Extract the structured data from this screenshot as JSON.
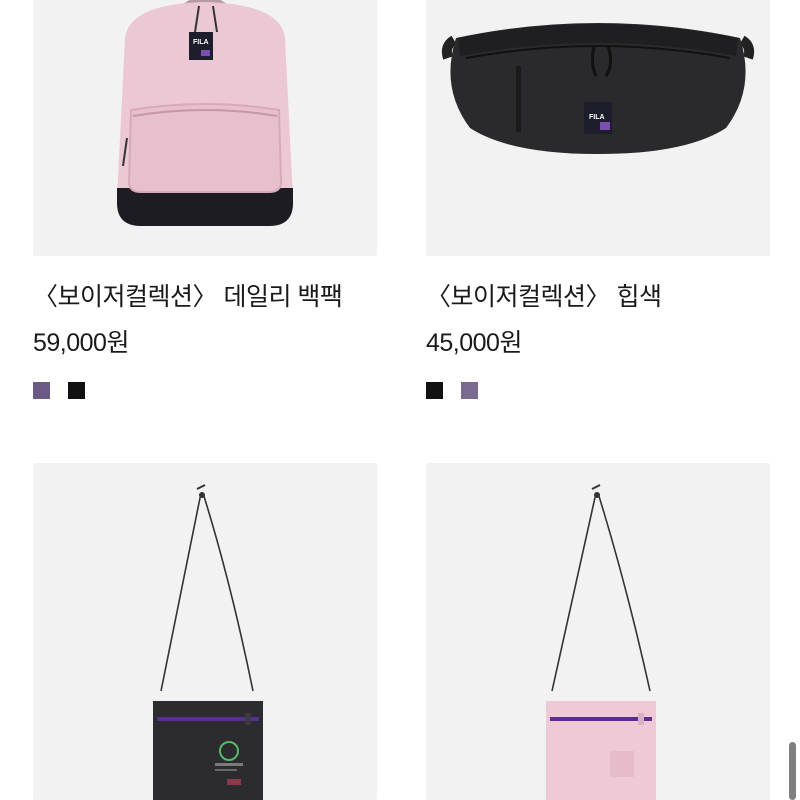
{
  "products": [
    {
      "title": "〈보이저컬렉션〉 데일리 백팩",
      "price": "59,000원",
      "image": "pink-backpack",
      "swatches": [
        "#6b5a86",
        "#111111"
      ],
      "tag_text": "FILA"
    },
    {
      "title": "〈보이저컬렉션〉 힙색",
      "price": "45,000원",
      "image": "black-hip-sack",
      "swatches": [
        "#111111",
        "#7b6a90"
      ],
      "tag_text": "FILA"
    },
    {
      "image": "black-cross-pouch"
    },
    {
      "image": "pink-cross-pouch"
    }
  ],
  "colors": {
    "thumb_bg": "#f2f2f2",
    "pink_bag": "#ecc8d4",
    "black_bag": "#2a2a2c",
    "accent_purple": "#5a2d91"
  }
}
